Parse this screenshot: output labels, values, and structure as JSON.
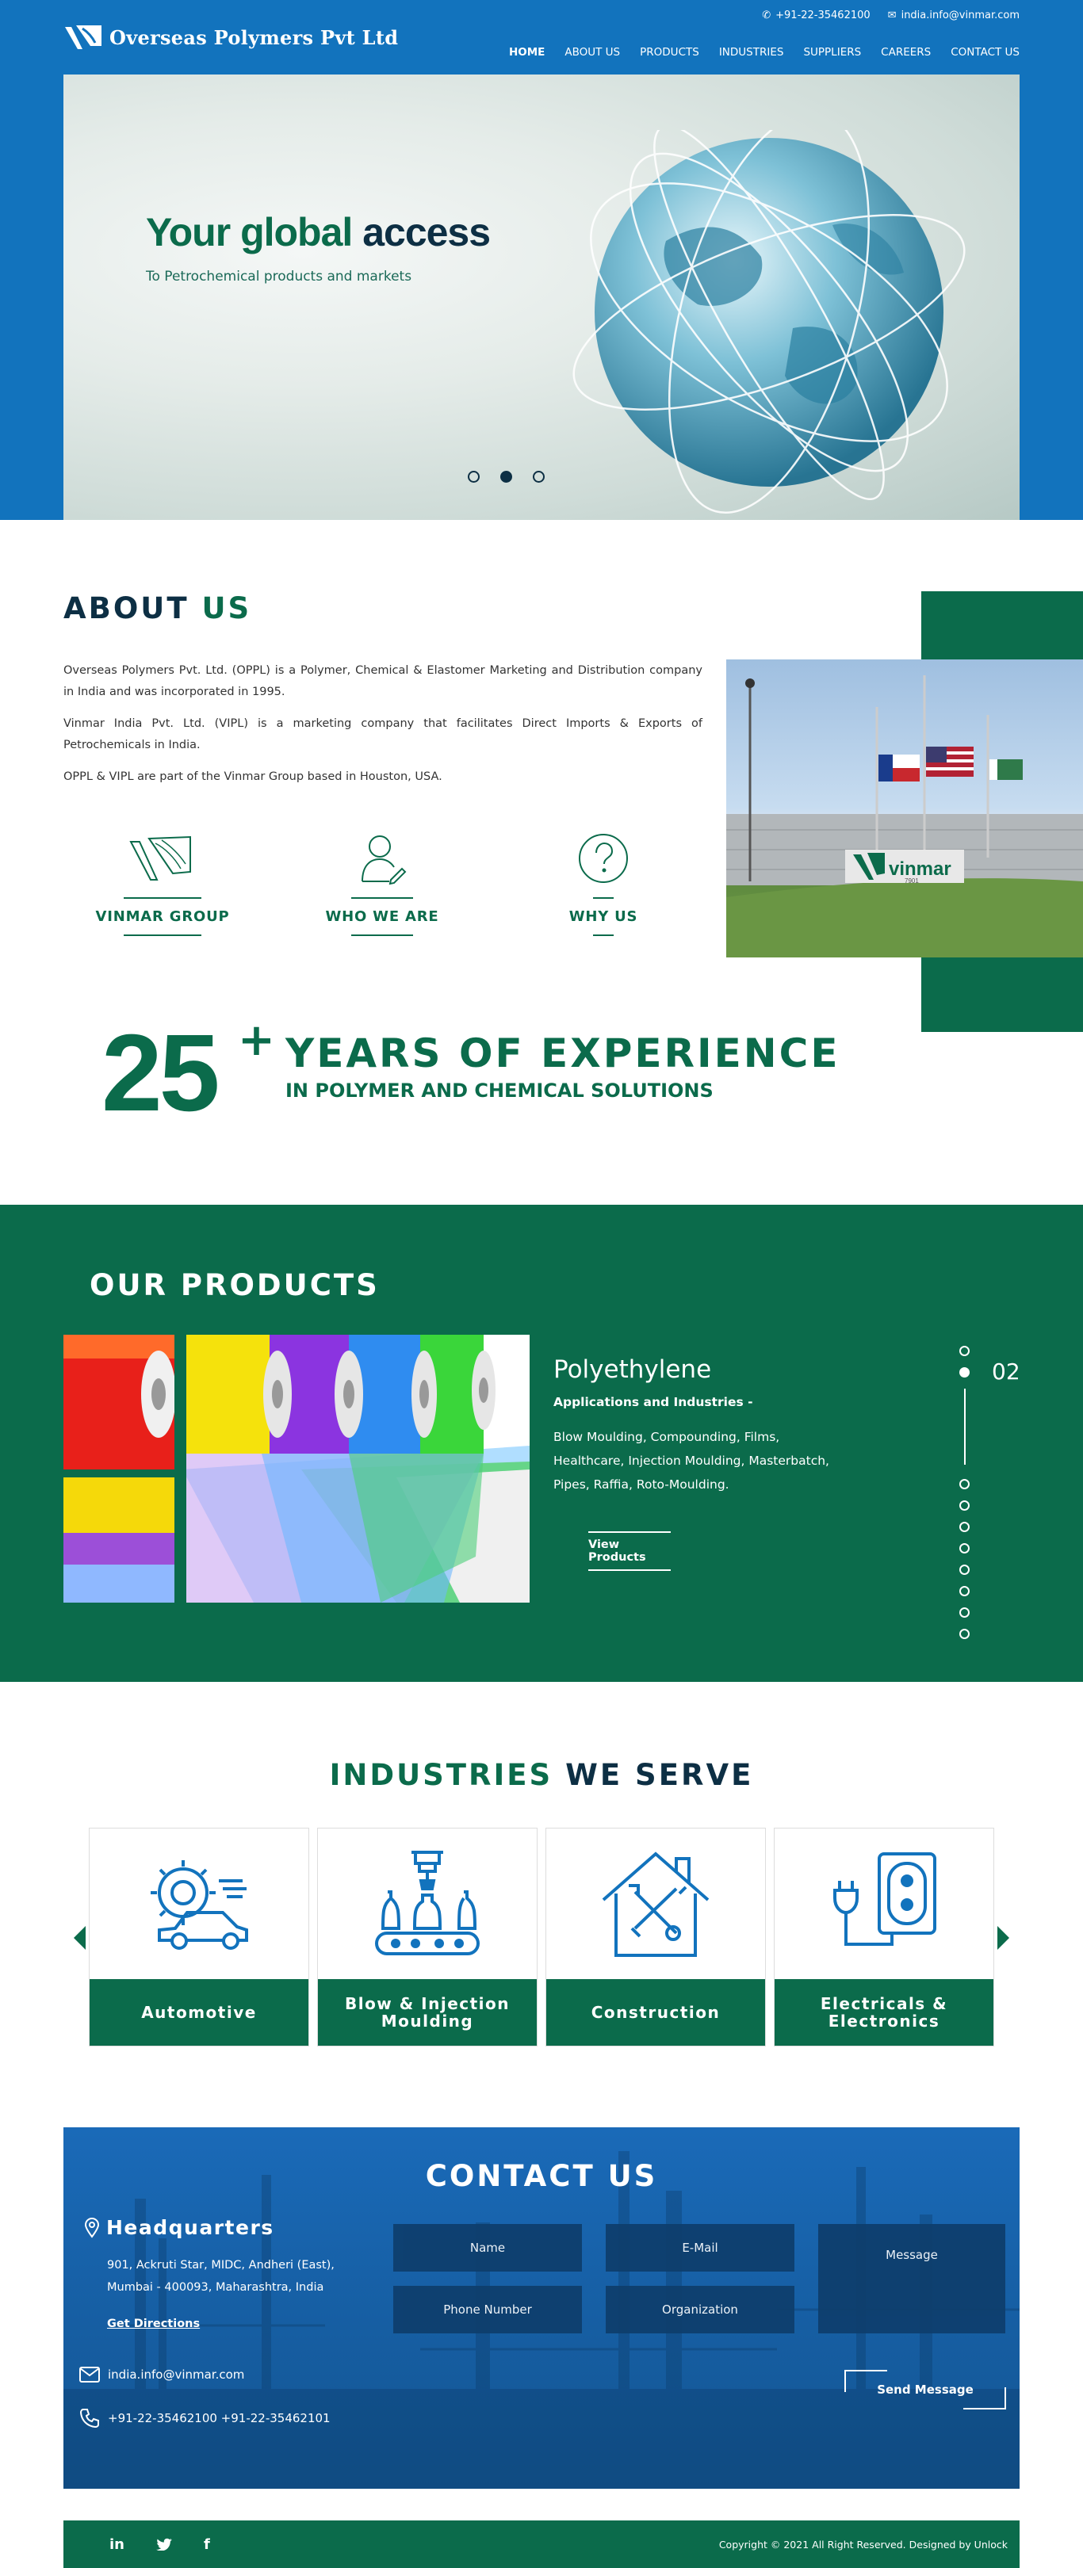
{
  "header": {
    "brand": "Overseas Polymers Pvt Ltd",
    "phone": "+91-22-35462100",
    "email": "india.info@vinmar.com",
    "nav": [
      "HOME",
      "ABOUT US",
      "PRODUCTS",
      "INDUSTRIES",
      "SUPPLIERS",
      "CAREERS",
      "CONTACT US"
    ],
    "active_nav": "HOME"
  },
  "hero": {
    "title_a": "Your global",
    "title_b": "access",
    "subtitle": "To Petrochemical products and markets",
    "slides": 3,
    "active_slide": 2
  },
  "about": {
    "title_a": "ABOUT",
    "title_b": "US",
    "paragraphs": [
      "Overseas Polymers Pvt. Ltd. (OPPL) is a Polymer, Chemical & Elastomer Marketing and Distribution company in India and was incorporated in 1995.",
      "Vinmar India Pvt. Ltd. (VIPL) is a marketing company that facilitates Direct Imports & Exports of Petrochemicals in India.",
      "OPPL & VIPL are part of the Vinmar Group based in Houston, USA."
    ],
    "features": [
      "VINMAR GROUP",
      "WHO WE ARE",
      "WHY US"
    ],
    "sign_text": "vinmar",
    "sign_number": "7901"
  },
  "experience": {
    "number": "25",
    "plus": "+",
    "line1": "YEARS OF EXPERIENCE",
    "line2": "IN POLYMER AND CHEMICAL SOLUTIONS"
  },
  "products": {
    "title": "OUR PRODUCTS",
    "name": "Polyethylene",
    "sub": "Applications and Industries -",
    "desc": "Blow Moulding, Compounding, Films, Healthcare, Injection Moulding, Masterbatch, Pipes, Raffia, Roto-Moulding.",
    "button": "View Products",
    "slide_number": "02",
    "total_dots": 10,
    "active_dot": 2
  },
  "industries": {
    "title_a": "INDUSTRIES",
    "title_b": "WE SERVE",
    "cards": [
      "Automotive",
      "Blow & Injection Moulding",
      "Construction",
      "Electricals & Electronics"
    ]
  },
  "contact": {
    "title": "CONTACT US",
    "hq_title": "Headquarters",
    "address_1": "901, Ackruti Star, MIDC, Andheri (East),",
    "address_2": "Mumbai - 400093, Maharashtra, India",
    "directions": "Get Directions",
    "email": "india.info@vinmar.com",
    "phones": "+91-22-35462100  +91-22-35462101",
    "fields": {
      "name": "Name",
      "email": "E-Mail",
      "message": "Message",
      "phone": "Phone Number",
      "org": "Organization"
    },
    "send": "Send Message"
  },
  "footer": {
    "social": [
      "in",
      "twitter",
      "f"
    ],
    "copyright": "Copyright © 2021 All Right Reserved. Designed by Unlock"
  },
  "colors": {
    "blue": "#1273bd",
    "green": "#0b6b4b",
    "navy": "#0d2f44"
  }
}
